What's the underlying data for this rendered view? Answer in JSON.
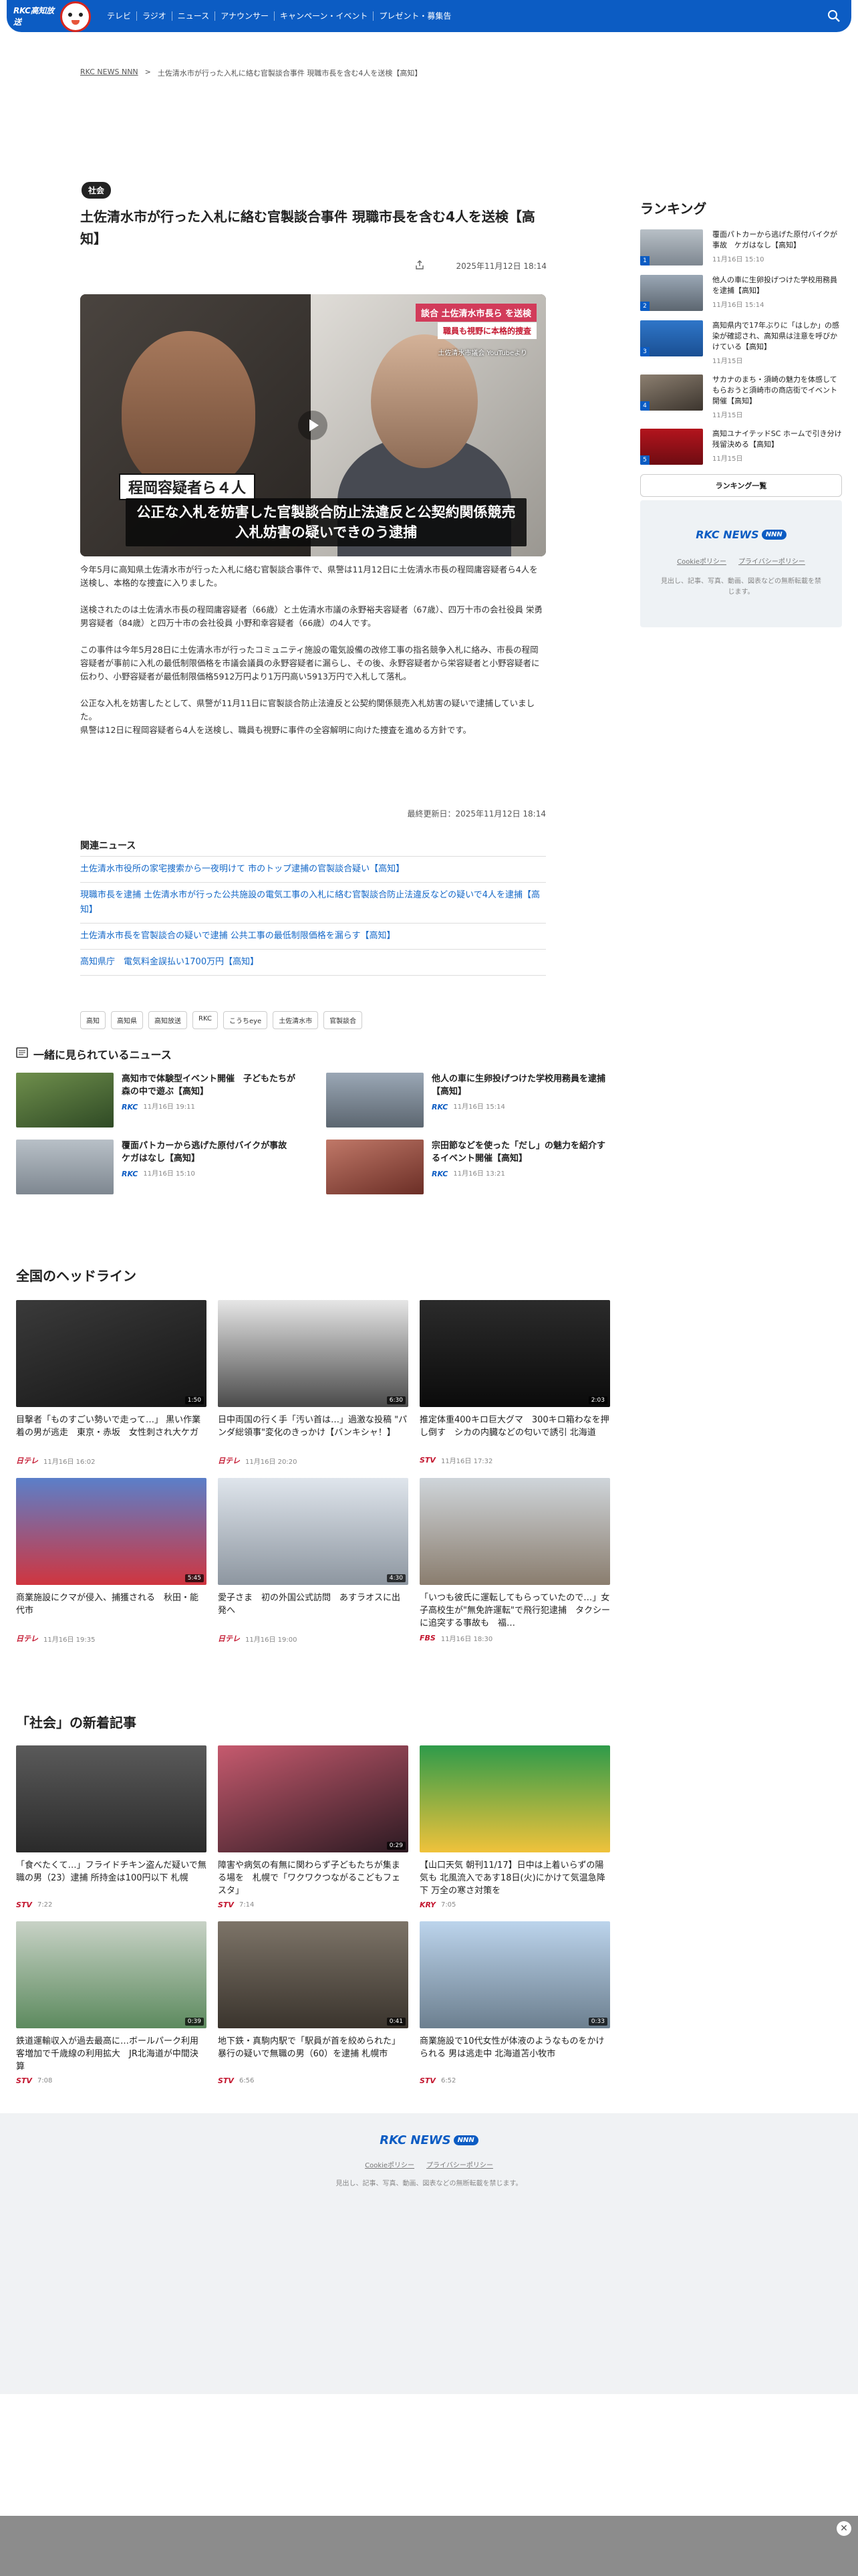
{
  "header": {
    "logo": "RKC高知放送",
    "nav": [
      "テレビ",
      "ラジオ",
      "ニュース",
      "アナウンサー",
      "キャンペーン・イベント",
      "プレゼント・募集告"
    ]
  },
  "breadcrumb": {
    "home": "RKC NEWS NNN",
    "sep": ">",
    "current": "土佐清水市が行った入札に絡む官製談合事件 現職市長を含む4人を送検【高知】"
  },
  "article": {
    "category": "社会",
    "title": "土佐清水市が行った入札に絡む官製談合事件 現職市長を含む4人を送検【高知】",
    "date": "2025年11月12日 18:14",
    "hero": {
      "tag1": "談合 土佐清水市長ら を送検",
      "tag2": "職員も視野に本格的捜査",
      "source": "土佐清水市議会 YouTubeより",
      "suspect": "程岡容疑者ら４人",
      "caption": "公正な入札を妨害した官製談合防止法違反と公契約関係競売入札妨害の疑いできのう逮捕"
    },
    "paragraphs": [
      "今年5月に高知県土佐清水市が行った入札に絡む官製談合事件で、県警は11月12日に土佐清水市長の程岡庸容疑者ら4人を送検し、本格的な捜査に入りました。",
      "送検されたのは土佐清水市長の程岡庸容疑者（66歳）と土佐清水市議の永野裕夫容疑者（67歳）、四万十市の会社役員 栄勇男容疑者（84歳）と四万十市の会社役員 小野和幸容疑者（66歳）の4人です。",
      "この事件は今年5月28日に土佐清水市が行ったコミュニティ施設の電気設備の改修工事の指名競争入札に絡み、市長の程岡容疑者が事前に入札の最低制限価格を市議会議員の永野容疑者に漏らし、その後、永野容疑者から栄容疑者と小野容疑者に伝わり、小野容疑者が最低制限価格5912万円より1万円高い5913万円で入札して落札。",
      "公正な入札を妨害したとして、県警が11月11日に官製談合防止法違反と公契約関係競売入札妨害の疑いで逮捕していました。\n県警は12日に程岡容疑者ら4人を送検し、職員も視野に事件の全容解明に向けた捜査を進める方針です。"
    ],
    "updated": "最終更新日：2025年11月12日 18:14"
  },
  "related": {
    "title": "関連ニュース",
    "items": [
      "土佐清水市役所の家宅捜索から一夜明けて 市のトップ逮捕の官製談合疑い【高知】",
      "現職市長を逮捕 土佐清水市が行った公共施設の電気工事の入札に絡む官製談合防止法違反などの疑いで4人を逮捕【高知】",
      "土佐清水市長を官製談合の疑いで逮捕 公共工事の最低制限価格を漏らす【高知】",
      "高知県庁　電気料金誤払い1700万円【高知】"
    ]
  },
  "tags": [
    "高知",
    "高知県",
    "高知放送",
    "RKC",
    "こうちeye",
    "土佐清水市",
    "官製談合"
  ],
  "together": {
    "title": "一緒に見られているニュース",
    "items": [
      {
        "title": "高知市で体験型イベント開催　子どもたちが森の中で遊ぶ【高知】",
        "src": "RKC",
        "date": "11月16日 19:11"
      },
      {
        "title": "他人の車に生卵投げつけた学校用務員を逮捕【高知】",
        "src": "RKC",
        "date": "11月16日 15:14"
      },
      {
        "title": "覆面パトカーから逃げた原付バイクが事故　ケガはなし【高知】",
        "src": "RKC",
        "date": "11月16日 15:10"
      },
      {
        "title": "宗田節などを使った「だし」の魅力を紹介するイベント開催【高知】",
        "src": "RKC",
        "date": "11月16日 13:21"
      }
    ]
  },
  "headlines": {
    "title": "全国のヘッドライン",
    "items": [
      {
        "title": "目撃者「ものすごい勢いで走って…」 黒い作業着の男が逃走　東京・赤坂　女性刺され大ケガ",
        "src": "日テレ",
        "date": "11月16日 16:02",
        "dur": "1:50"
      },
      {
        "title": "日中両国の行く手「汚い首は…」過激な投稿 \"パンダ総領事\"変化のきっかけ【バンキシャ！】",
        "src": "日テレ",
        "date": "11月16日 20:20",
        "dur": "6:30"
      },
      {
        "title": "推定体重400キロ巨大グマ　300キロ箱わなを押し倒す　シカの内臓などの匂いで誘引 北海道",
        "src": "STV",
        "date": "11月16日 17:32",
        "dur": "2:03"
      },
      {
        "title": "商業施設にクマが侵入、捕獲される　秋田・能代市",
        "src": "日テレ",
        "date": "11月16日 19:35",
        "dur": "5:45"
      },
      {
        "title": "愛子さま　初の外国公式訪問　あすラオスに出発へ",
        "src": "日テレ",
        "date": "11月16日 19:00",
        "dur": "4:30"
      },
      {
        "title": "「いつも彼氏に運転してもらっていたので…」女子高校生が\"無免許運転\"で飛行犯逮捕　タクシーに追突する事故も　福…",
        "src": "FBS",
        "date": "11月16日 18:30",
        "dur": ""
      }
    ]
  },
  "shakai": {
    "title": "「社会」の新着記事",
    "items": [
      {
        "title": "「食べたくて…」フライドチキン盗んだ疑いで無職の男（23）逮捕 所持金は100円以下 札幌",
        "src": "STV",
        "date": "7:22",
        "dur": ""
      },
      {
        "title": "障害や病気の有無に関わらず子どもたちが集まる場を　札幌で「ワクワクつながるこどもフェスタ」",
        "src": "STV",
        "date": "7:14",
        "dur": "0:29"
      },
      {
        "title": "【山口天気 朝刊11/17】日中は上着いらずの陽気も 北風流入であす18日(火)にかけて気温急降下 万全の寒さ対策を",
        "src": "KRY",
        "date": "7:05",
        "dur": ""
      },
      {
        "title": "鉄道運輸収入が過去最高に…ボールパーク利用客増加で千歳線の利用拡大　JR北海道が中間決算",
        "src": "STV",
        "date": "7:08",
        "dur": "0:39"
      },
      {
        "title": "地下鉄・真駒内駅で「駅員が首を絞められた」暴行の疑いで無職の男（60）を逮捕 札幌市",
        "src": "STV",
        "date": "6:56",
        "dur": "0:41"
      },
      {
        "title": "商業施設で10代女性が体液のようなものをかけられる 男は逃走中 北海道苫小牧市",
        "src": "STV",
        "date": "6:52",
        "dur": "0:33"
      }
    ]
  },
  "ranking": {
    "title": "ランキング",
    "items": [
      {
        "title": "覆面パトカーから逃げた原付バイクが事故　ケガはなし【高知】",
        "date": "11月16日 15:10"
      },
      {
        "title": "他人の車に生卵投げつけた学校用務員を逮捕【高知】",
        "date": "11月16日 15:14"
      },
      {
        "title": "高知県内で17年ぶりに「はしか」の感染が確認され、高知県は注意を呼びかけている【高知】",
        "date": "11月15日"
      },
      {
        "title": "サカナのまち・須崎の魅力を体感してもらおうと須崎市の商店街でイベント開催【高知】",
        "date": "11月15日"
      },
      {
        "title": "高知ユナイテッドSC ホームで引き分け 残留決める【高知】",
        "date": "11月15日"
      }
    ],
    "more": "ランキング一覧"
  },
  "brand": {
    "name": "RKC NEWS",
    "pill": "NNN"
  },
  "footer_links": [
    "Cookieポリシー",
    "プライバシーポリシー"
  ],
  "footer_note": "見出し、記事、写真、動画、図表などの無断転載を禁じます。",
  "icons": {
    "search": "search-icon",
    "share": "share-icon",
    "close": "close-icon",
    "news": "news-icon",
    "play": "play-icon"
  },
  "colors": {
    "brand": "#0c5cc3",
    "link": "#1468c8",
    "ntv": "#c3162f"
  }
}
